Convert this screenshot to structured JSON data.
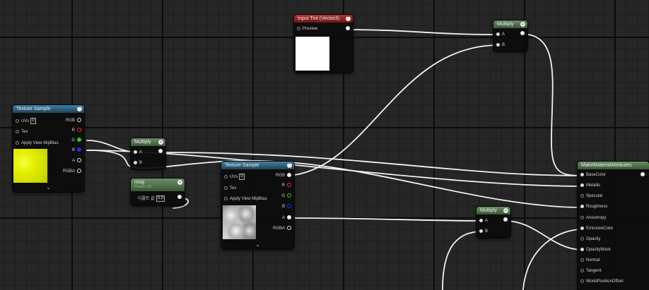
{
  "colors": {
    "header_texture": "#2f6584",
    "header_math": "#55774f",
    "header_param": "#7a1f1f",
    "pin_r": "#ff2b2b",
    "pin_g": "#21d21b",
    "pin_b": "#1b2cff",
    "swatch_yellow": "#eaf200"
  },
  "nodes": {
    "tex1": {
      "title": "Texture Sample",
      "uvs_label": "UVs",
      "uvs_value": "0",
      "tex_label": "Tex",
      "mip_label": "Apply View MipBias",
      "outputs": [
        "RGB",
        "R",
        "G",
        "B",
        "A",
        "RGBA"
      ],
      "expand_icon": "chevron-down"
    },
    "mul1": {
      "title": "Multiply",
      "in_a": "A",
      "in_b": "B"
    },
    "roug": {
      "title": "roug",
      "subtitle": "Param (0)",
      "default_label": "디폴트 값",
      "default_value": "0.0"
    },
    "tint": {
      "title": "Input Tint (Vector3)",
      "preview_label": "Preview"
    },
    "mul2": {
      "title": "Multiply",
      "in_a": "A",
      "in_b": "B"
    },
    "tex2": {
      "title": "Texture Sample",
      "uvs_label": "UVs",
      "uvs_value": "0",
      "tex_label": "Tex",
      "mip_label": "Apply View MipBias",
      "outputs": [
        "RGB",
        "R",
        "G",
        "B",
        "A",
        "RGBA"
      ],
      "expand_icon": "chevron-down"
    },
    "mul3": {
      "title": "Multiply",
      "in_a": "A",
      "in_b": "B"
    },
    "mma": {
      "title": "MakeMaterialAttributes",
      "inputs": [
        "BaseColor",
        "Metallic",
        "Specular",
        "Roughness",
        "Anisotropy",
        "EmissiveColor",
        "Opacity",
        "OpacityMask",
        "Normal",
        "Tangent",
        "WorldPositionOffset"
      ]
    }
  }
}
